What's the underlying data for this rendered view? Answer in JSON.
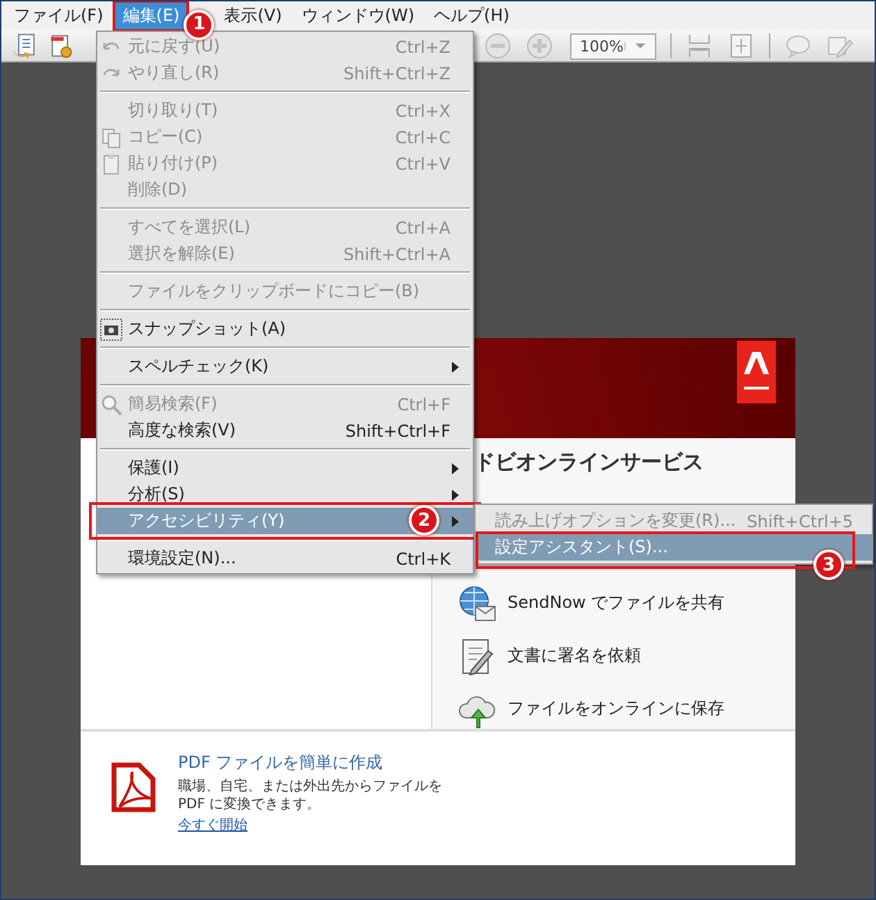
{
  "menubar": [
    {
      "label": "ファイル(F)",
      "selected": false
    },
    {
      "label": "編集(E)",
      "selected": true,
      "callout": "1"
    },
    {
      "label": "表示(V)",
      "selected": false
    },
    {
      "label": "ウィンドウ(W)",
      "selected": false
    },
    {
      "label": "ヘルプ(H)",
      "selected": false
    }
  ],
  "toolbar": {
    "zoom": "100%"
  },
  "edit_menu": [
    {
      "kind": "item",
      "label": "元に戻す(U)",
      "shortcut": "Ctrl+Z",
      "disabled": true,
      "selected": false,
      "has_submenu": false
    },
    {
      "kind": "item",
      "label": "やり直し(R)",
      "shortcut": "Shift+Ctrl+Z",
      "disabled": true,
      "selected": false,
      "has_submenu": false
    },
    {
      "kind": "separator"
    },
    {
      "kind": "item",
      "label": "切り取り(T)",
      "shortcut": "Ctrl+X",
      "disabled": true,
      "selected": false,
      "has_submenu": false
    },
    {
      "kind": "item",
      "label": "コピー(C)",
      "shortcut": "Ctrl+C",
      "disabled": true,
      "selected": false,
      "has_submenu": false
    },
    {
      "kind": "item",
      "label": "貼り付け(P)",
      "shortcut": "Ctrl+V",
      "disabled": true,
      "selected": false,
      "has_submenu": false
    },
    {
      "kind": "item",
      "label": "削除(D)",
      "disabled": true,
      "selected": false,
      "has_submenu": false
    },
    {
      "kind": "separator"
    },
    {
      "kind": "item",
      "label": "すべてを選択(L)",
      "shortcut": "Ctrl+A",
      "disabled": true,
      "selected": false,
      "has_submenu": false
    },
    {
      "kind": "item",
      "label": "選択を解除(E)",
      "shortcut": "Shift+Ctrl+A",
      "disabled": true,
      "selected": false,
      "has_submenu": false
    },
    {
      "kind": "separator"
    },
    {
      "kind": "item",
      "label": "ファイルをクリップボードにコピー(B)",
      "disabled": true,
      "selected": false,
      "has_submenu": false
    },
    {
      "kind": "separator"
    },
    {
      "kind": "item",
      "label": "スナップショット(A)",
      "disabled": false,
      "selected": false,
      "has_submenu": false
    },
    {
      "kind": "separator"
    },
    {
      "kind": "item",
      "label": "スペルチェック(K)",
      "disabled": false,
      "selected": false,
      "has_submenu": true
    },
    {
      "kind": "separator"
    },
    {
      "kind": "item",
      "label": "簡易検索(F)",
      "shortcut": "Ctrl+F",
      "disabled": true,
      "selected": false,
      "has_submenu": false
    },
    {
      "kind": "item",
      "label": "高度な検索(V)",
      "shortcut": "Shift+Ctrl+F",
      "disabled": false,
      "selected": false,
      "has_submenu": false
    },
    {
      "kind": "separator"
    },
    {
      "kind": "item",
      "label": "保護(I)",
      "disabled": false,
      "selected": false,
      "has_submenu": true
    },
    {
      "kind": "item",
      "label": "分析(S)",
      "disabled": false,
      "selected": false,
      "has_submenu": true
    },
    {
      "kind": "item",
      "label": "アクセシビリティ(Y)",
      "disabled": false,
      "selected": true,
      "has_submenu": true,
      "callout": "2",
      "submenu": [
        {
          "label": "読み上げオプションを変更(R)...",
          "shortcut": "Shift+Ctrl+5",
          "disabled": true,
          "selected": false
        },
        {
          "label": "設定アシスタント(S)...",
          "disabled": false,
          "selected": true,
          "callout": "3"
        }
      ]
    },
    {
      "kind": "separator"
    },
    {
      "kind": "item",
      "label": "環境設定(N)...",
      "shortcut": "Ctrl+K",
      "disabled": false,
      "selected": false,
      "has_submenu": false
    }
  ],
  "services": {
    "heading": "ドビオンラインサービス",
    "items": [
      {
        "label": "SendNow でファイルを共有"
      },
      {
        "label": "文書に署名を依頼"
      },
      {
        "label": "ファイルをオンラインに保存"
      }
    ]
  },
  "promo": {
    "title": "PDF ファイルを簡単に作成",
    "description": "職場、自宅、または外出先からファイルを PDF に変換できます。",
    "link": "今すぐ開始"
  }
}
